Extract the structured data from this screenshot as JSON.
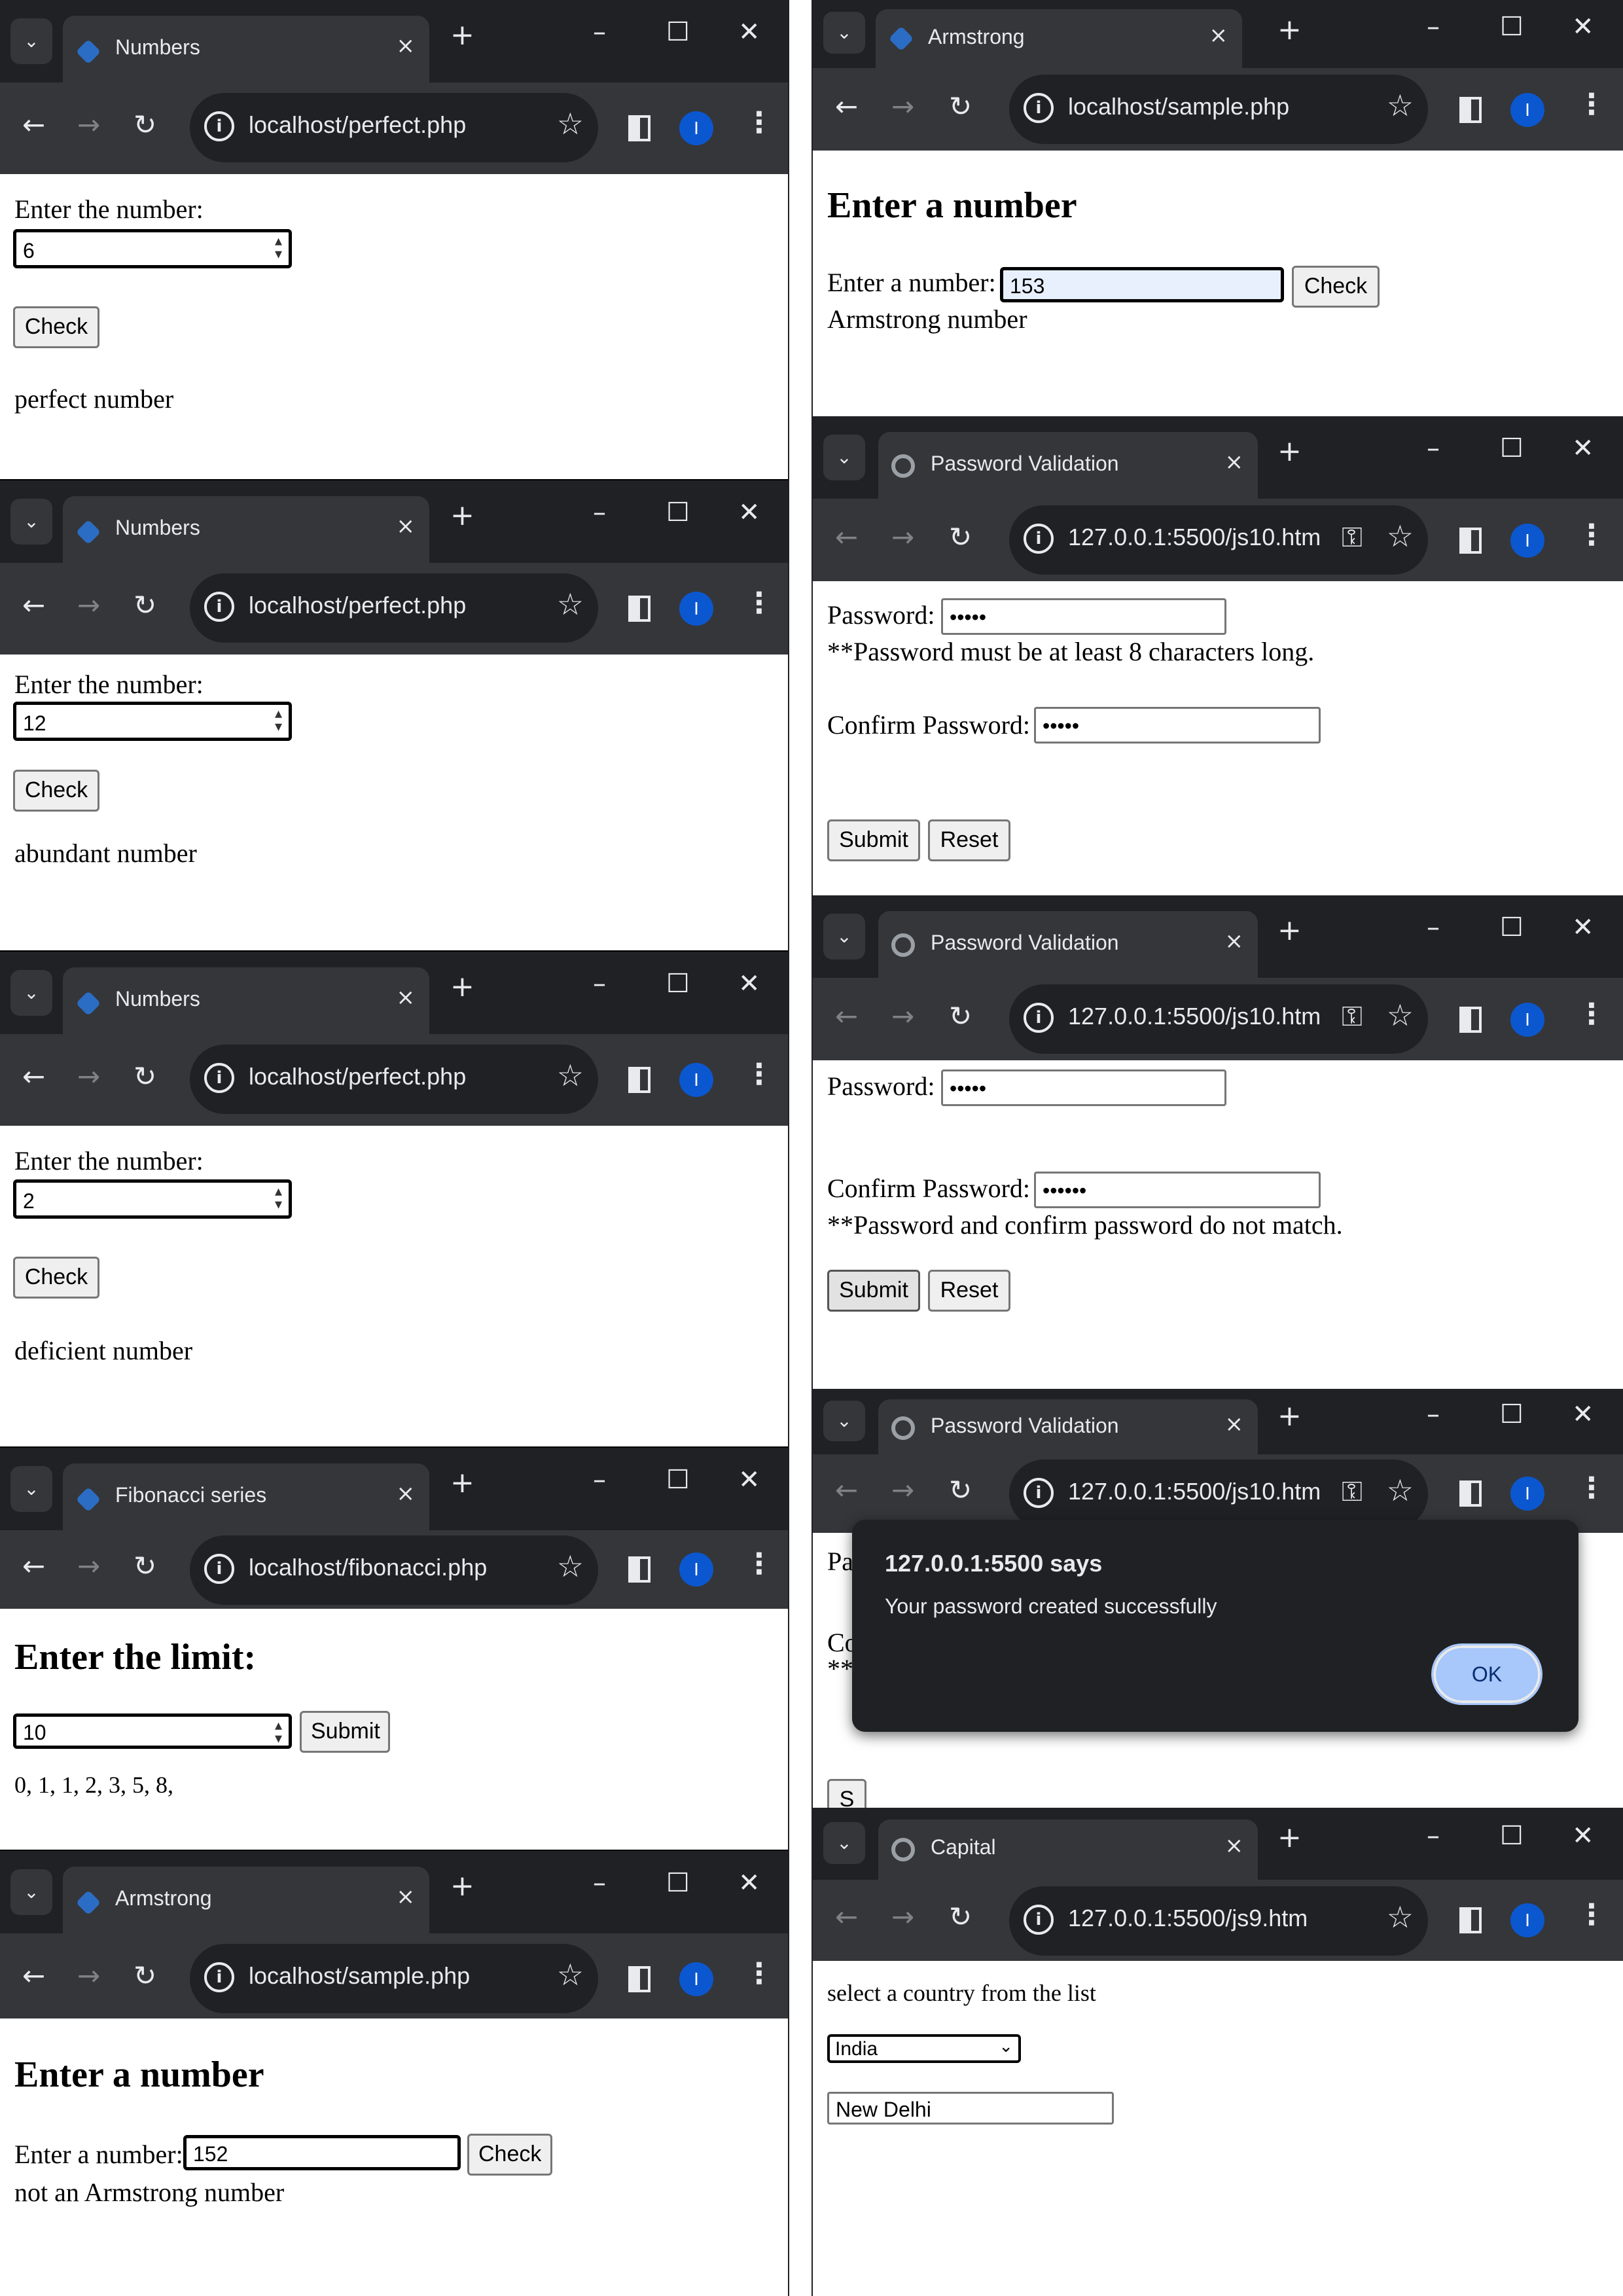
{
  "browser": {
    "close_symbol": "×",
    "new_tab_symbol": "+",
    "minimize_symbol": "–",
    "maximize_symbol": "☐",
    "window_close_symbol": "✕",
    "back_symbol": "←",
    "forward_symbol": "→",
    "reload_symbol": "↻",
    "star_symbol": "☆",
    "menu_symbol": "⋮",
    "profile_initial": "I",
    "tab_dropdown_symbol": "⌄",
    "info_symbol": "i",
    "key_symbol": "⚿"
  },
  "windows": {
    "perfect6": {
      "tab_title": "Numbers",
      "url": "localhost/perfect.php",
      "label": "Enter the number:",
      "input_value": "6",
      "check_label": "Check",
      "result": "perfect number"
    },
    "perfect12": {
      "tab_title": "Numbers",
      "url": "localhost/perfect.php",
      "label": "Enter the number:",
      "input_value": "12",
      "check_label": "Check",
      "result": "abundant number"
    },
    "perfect2": {
      "tab_title": "Numbers",
      "url": "localhost/perfect.php",
      "label": "Enter the number:",
      "input_value": "2",
      "check_label": "Check",
      "result": "deficient number"
    },
    "fibonacci": {
      "tab_title": "Fibonacci series",
      "url": "localhost/fibonacci.php",
      "heading": "Enter the limit:",
      "input_value": "10",
      "submit_label": "Submit",
      "result": "0, 1, 1, 2, 3, 5, 8,"
    },
    "armstrong152": {
      "tab_title": "Armstrong",
      "url": "localhost/sample.php",
      "heading": "Enter a number",
      "label": "Enter a number:",
      "input_value": "152",
      "check_label": "Check",
      "result": "not an Armstrong number"
    },
    "armstrong153": {
      "tab_title": "Armstrong",
      "url": "localhost/sample.php",
      "heading": "Enter a number",
      "label": "Enter a number:",
      "input_value": "153",
      "check_label": "Check",
      "result": "Armstrong number"
    },
    "password1": {
      "tab_title": "Password Validation",
      "url": "127.0.0.1:5500/js10.htm",
      "password_label": "Password:",
      "password_value": "•••••",
      "error1": "**Password must be at least 8 characters long.",
      "confirm_label": "Confirm Password:",
      "confirm_value": "•••••",
      "submit_label": "Submit",
      "reset_label": "Reset"
    },
    "password2": {
      "tab_title": "Password Validation",
      "url": "127.0.0.1:5500/js10.htm",
      "password_label": "Password:",
      "password_value": "•••••",
      "confirm_label": "Confirm Password:",
      "confirm_value": "••••••",
      "error2": "**Password and confirm password do not match.",
      "submit_label": "Submit",
      "reset_label": "Reset"
    },
    "password3": {
      "tab_title": "Password Validation",
      "url": "127.0.0.1:5500/js10.htm",
      "bg_pa": "Pa",
      "bg_co": "Co",
      "bg_stars": "**",
      "bg_s": "S",
      "dialog_title": "127.0.0.1:5500 says",
      "dialog_message": "Your password created successfully",
      "ok_label": "OK"
    },
    "capital": {
      "tab_title": "Capital",
      "url": "127.0.0.1:5500/js9.htm",
      "prompt": "select a country from the list",
      "selected_country": "India",
      "select_arrow": "⌄",
      "capital_value": "New Delhi"
    }
  }
}
